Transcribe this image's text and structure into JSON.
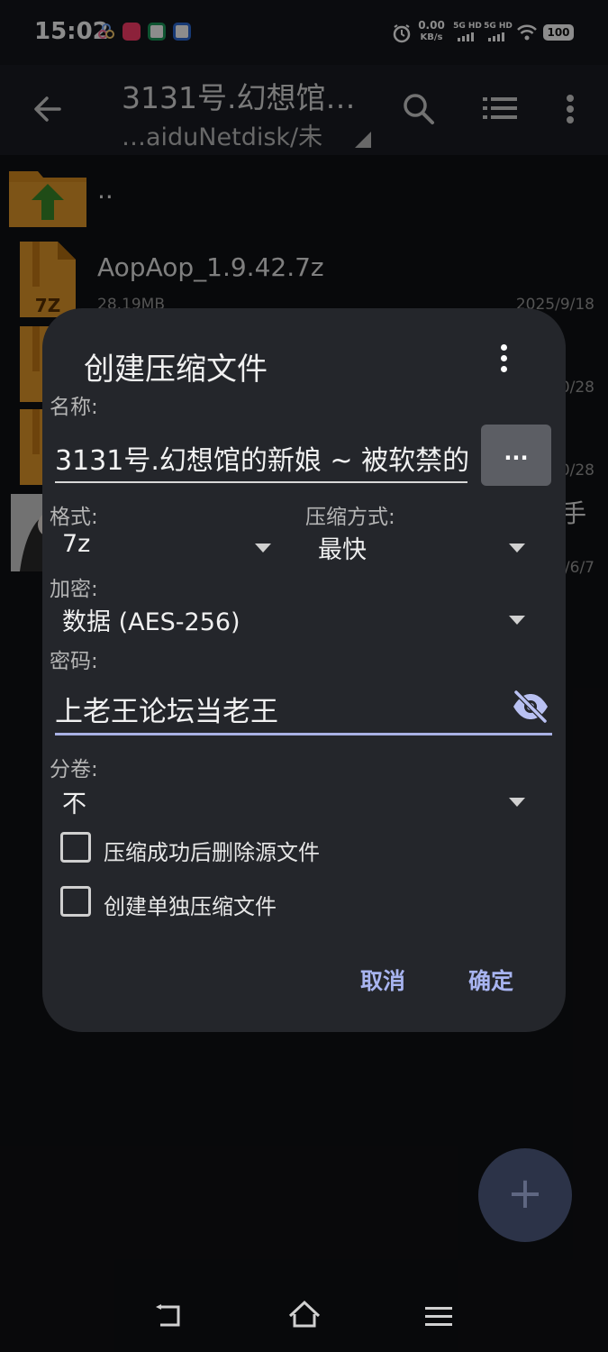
{
  "status_bar": {
    "time": "15:02",
    "speed_value": "0.00",
    "speed_unit": "KB/s",
    "sig1": "5G HD",
    "sig2": "5G HD",
    "battery": "100"
  },
  "toolbar": {
    "title": "3131号.幻想馆…",
    "subtitle": "…aiduNetdisk/未"
  },
  "files": [
    {
      "name": "..",
      "meta_left": "",
      "meta_right": ""
    },
    {
      "name": "AopAop_1.9.42.7z",
      "meta_left": "28.19MB",
      "meta_right": "2025/9/18"
    },
    {
      "name": "",
      "meta_left": "",
      "meta_right": "0/28"
    },
    {
      "name": "",
      "meta_left": "",
      "meta_right": "0/28"
    },
    {
      "name": "手",
      "meta_left": "",
      "meta_right": "/6/7"
    }
  ],
  "dialog": {
    "title": "创建压缩文件",
    "name_label": "名称:",
    "name_value": "3131号.幻想馆的新娘 ~ 被软禁的",
    "browse_label": "...",
    "format_label": "格式:",
    "format_value": "7z",
    "method_label": "压缩方式:",
    "method_value": "最快",
    "encrypt_label": "加密:",
    "encrypt_value": "数据 (AES-256)",
    "password_label": "密码:",
    "password_value": "上老王论坛当老王",
    "split_label": "分卷:",
    "split_value": "不",
    "delete_source_label": "压缩成功后删除源文件",
    "separate_label": "创建单独压缩文件",
    "cancel_label": "取消",
    "ok_label": "确定"
  },
  "fab_label": "+",
  "colors": {
    "accent": "#a8b4f0",
    "dialog_bg": "#24262b",
    "folder": "#d98c1f",
    "arrow_green": "#3a8a2a"
  }
}
